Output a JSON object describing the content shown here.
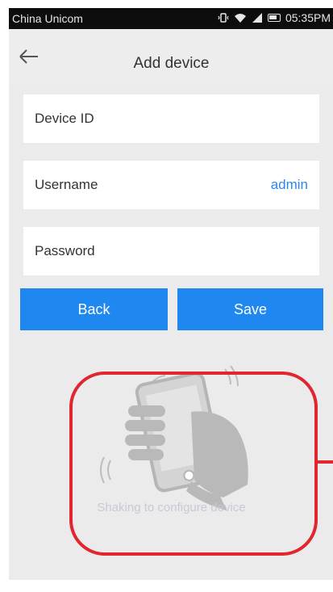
{
  "status_bar": {
    "carrier": "China Unicom",
    "time": "05:35PM"
  },
  "nav": {
    "title": "Add device"
  },
  "form": {
    "device_id": {
      "label": "Device ID",
      "value": ""
    },
    "username": {
      "label": "Username",
      "value": "admin"
    },
    "password": {
      "label": "Password",
      "value": ""
    }
  },
  "buttons": {
    "back_label": "Back",
    "save_label": "Save"
  },
  "shake_hint": "Shaking to configure device",
  "colors": {
    "accent": "#1e87f0",
    "link": "#2f86e8",
    "highlight": "#e0262e"
  },
  "icons": {
    "back": "back-arrow-icon",
    "shake": "shake-phone-icon"
  }
}
